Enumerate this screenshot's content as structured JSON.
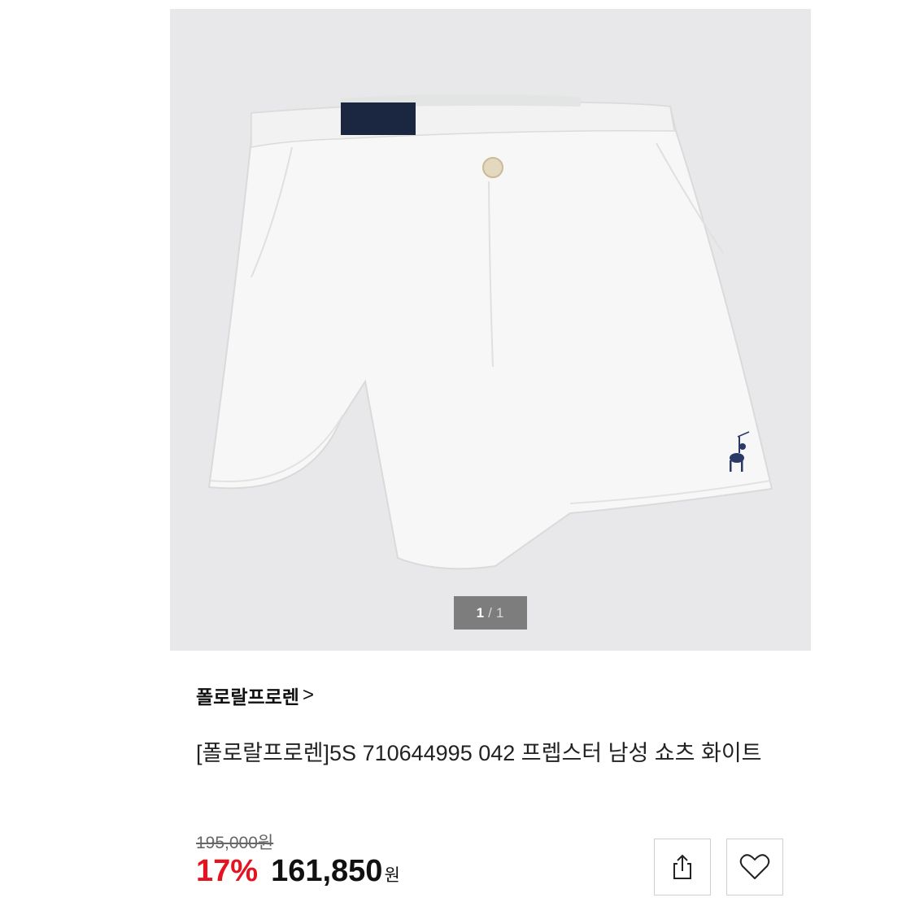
{
  "gallery": {
    "current_page": "1",
    "separator": "/",
    "total_pages": "1"
  },
  "product": {
    "brand": "폴로랄프로렌",
    "brand_chevron": ">",
    "title": "[폴로랄프로렌]5S 710644995 042 프렙스터 남성 쇼츠 화이트",
    "original_price": "195,000원",
    "discount": "17%",
    "sale_price": "161,850",
    "currency": "원"
  },
  "icons": {
    "share": "share-icon",
    "wishlist": "heart-icon",
    "logo": "polo-pony-logo"
  },
  "colors": {
    "discount": "#e5121f",
    "image_bg": "#e8e8ea",
    "indicator_bg": "#7d7d7d"
  }
}
